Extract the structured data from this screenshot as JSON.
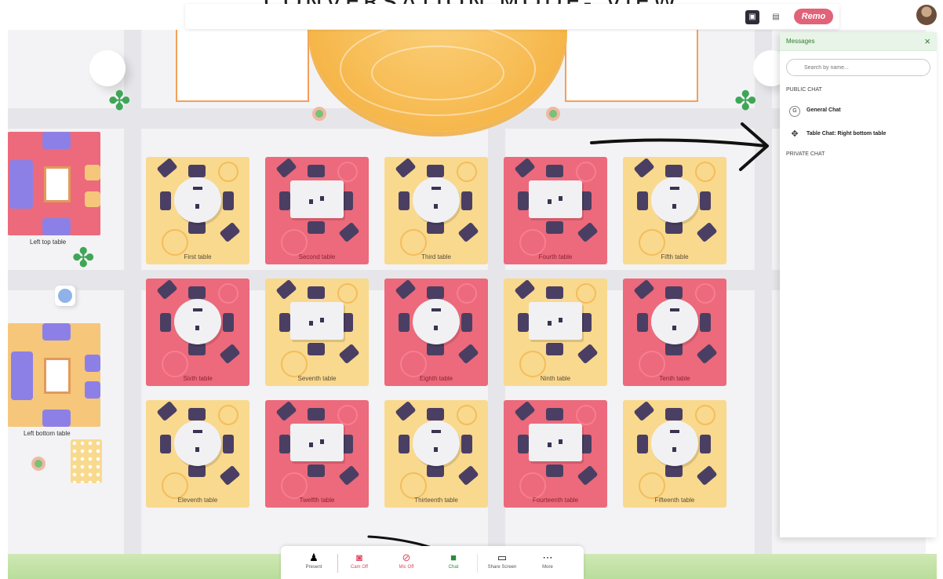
{
  "page_heading": "CONVERSATION MODE- VIEW",
  "top_bar": {
    "brand": "Remo"
  },
  "tables": {
    "row1": [
      "First table",
      "Second table",
      "Third table",
      "Fourth table",
      "Fifth table"
    ],
    "row2": [
      "Sixth table",
      "Seventh table",
      "Eighth table",
      "Ninth table",
      "Tenth table"
    ],
    "row3": [
      "Eleventh table",
      "Twelfth table",
      "Thirteenth table",
      "Fourteenth table",
      "Fifteenth table"
    ]
  },
  "side_tables": {
    "top_left": "Left top table",
    "bottom_left": "Left bottom table"
  },
  "messages": {
    "title": "Messages",
    "close": "×",
    "search_placeholder": "Search by name...",
    "public_label": "PUBLIC CHAT",
    "public_items": [
      {
        "avatar": "G",
        "name": "General Chat"
      },
      {
        "avatar": "✥",
        "name": "Table Chat: Right bottom table"
      }
    ],
    "private_label": "PRIVATE CHAT"
  },
  "toolbar": {
    "present": "Present",
    "cam": "Cam Off",
    "mic": "Mic Off",
    "chat": "Chat",
    "share": "Share Screen",
    "more": "More"
  },
  "colors": {
    "accent_green": "#2b8a3e",
    "brand_pink": "#e2627a",
    "table_red": "#ec6a7b",
    "table_yellow": "#f9d98d"
  }
}
